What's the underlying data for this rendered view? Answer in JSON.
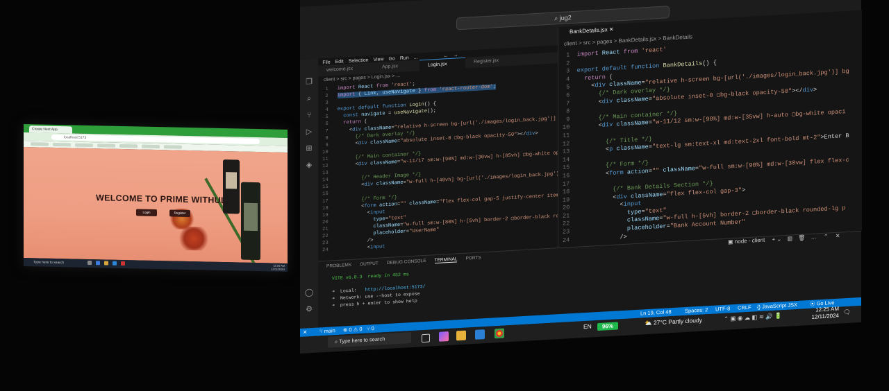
{
  "left_browser": {
    "tab_title": "Create Next App",
    "url": "localhost:5173",
    "heading": "WELCOME TO PRIME WITHUL",
    "login_button": "Login",
    "register_button": "Register",
    "taskbar_search": "Type here to search",
    "time": "12:25 AM",
    "date": "12/11/2024"
  },
  "vscode": {
    "search": "jug2",
    "menu": [
      "File",
      "Edit",
      "Selection",
      "View",
      "Go",
      "Run",
      "..."
    ],
    "tabs": [
      "welcome.jsx",
      "App.jsx",
      "Login.jsx",
      "Register.jsx"
    ],
    "breadcrumb1": "client > src > pages > Login.jsx > ...",
    "editor2_tab": "BankDetails.jsx",
    "breadcrumb2": "client > src > pages > BankDetails.jsx > BankDetails",
    "panel_tabs": [
      "PROBLEMS",
      "OUTPUT",
      "DEBUG CONSOLE",
      "TERMINAL",
      "PORTS"
    ],
    "terminal_label": "node - client",
    "terminal": {
      "vite": "VITE v6.0.3  ready in 452 ms",
      "local_label": "➜  Local:",
      "local_url": "http://localhost:5173/",
      "network": "➜  Network: use --host to expose",
      "help": "➜  press h + enter to show help"
    },
    "status": {
      "branch": "main",
      "problems": "⊗ 0 ⚠ 0",
      "ports": "⑂ 0",
      "position": "Ln 19, Col 48",
      "spaces": "Spaces: 2",
      "encoding": "UTF-8",
      "eol": "CRLF",
      "language": "{} JavaScript JSX",
      "golive": "Go Live"
    }
  },
  "taskbar": {
    "search": "Type here to search",
    "lang": "EN",
    "battery": "96%",
    "weather": "27°C  Partly cloudy",
    "time": "12:25 AM",
    "date": "12/11/2024"
  },
  "colors": {
    "accent": "#0078d4",
    "browser_chrome": "#2e9e3a",
    "page_bg": "#f0a58b",
    "battery": "#1fb84a"
  }
}
